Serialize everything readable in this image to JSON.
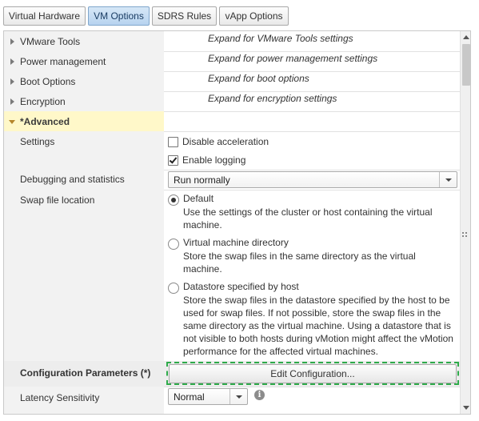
{
  "tabs": [
    {
      "label": "Virtual Hardware",
      "active": false
    },
    {
      "label": "VM Options",
      "active": true
    },
    {
      "label": "SDRS Rules",
      "active": false
    },
    {
      "label": "vApp Options",
      "active": false
    }
  ],
  "sections": [
    {
      "label": "VMware Tools",
      "hint": "Expand for VMware Tools settings"
    },
    {
      "label": "Power management",
      "hint": "Expand for power management settings"
    },
    {
      "label": "Boot Options",
      "hint": "Expand for boot options"
    },
    {
      "label": "Encryption",
      "hint": "Expand for encryption settings"
    }
  ],
  "advanced": {
    "label": "*Advanced",
    "settings": {
      "label": "Settings",
      "disable_acceleration": {
        "label": "Disable acceleration",
        "checked": false
      },
      "enable_logging": {
        "label": "Enable logging",
        "checked": true
      }
    },
    "debugging": {
      "label": "Debugging and statistics",
      "value": "Run normally"
    },
    "swap": {
      "label": "Swap file location",
      "options": [
        {
          "label": "Default",
          "selected": true,
          "description": "Use the settings of the cluster or host containing the virtual machine."
        },
        {
          "label": "Virtual machine directory",
          "selected": false,
          "description": "Store the swap files in the same directory as the virtual machine."
        },
        {
          "label": "Datastore specified by host",
          "selected": false,
          "description": "Store the swap files in the datastore specified by the host to be used for swap files. If not possible, store the swap files in the same directory as the virtual machine. Using a datastore that is not visible to both hosts during vMotion might affect the vMotion performance for the affected virtual machines."
        }
      ]
    },
    "config_params": {
      "label": "Configuration Parameters (*)",
      "button": "Edit Configuration..."
    },
    "latency": {
      "label": "Latency Sensitivity",
      "value": "Normal"
    }
  },
  "icons": {
    "collapsed": "chevron-right-icon",
    "expanded": "chevron-down-icon",
    "info": "info-icon",
    "info_glyph": "i"
  },
  "colors": {
    "active_tab": "#b7d3ef",
    "advanced_highlight": "#fff8c9",
    "focus_border": "#2eaa4a"
  }
}
